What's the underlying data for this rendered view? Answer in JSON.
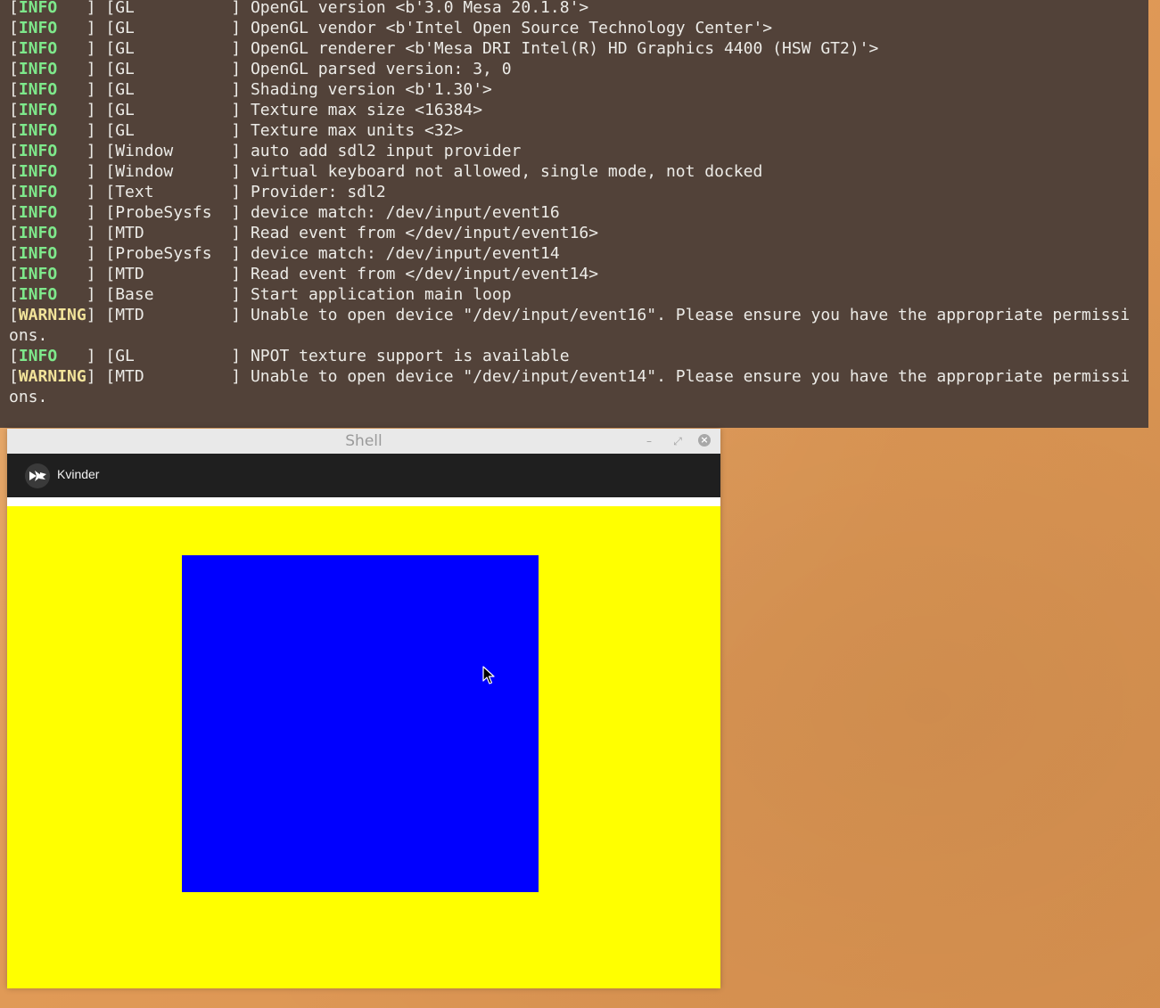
{
  "terminal": {
    "lines": [
      {
        "level": "INFO   ",
        "module": "GL          ",
        "message": "OpenGL version <b'3.0 Mesa 20.1.8'>"
      },
      {
        "level": "INFO   ",
        "module": "GL          ",
        "message": "OpenGL vendor <b'Intel Open Source Technology Center'>"
      },
      {
        "level": "INFO   ",
        "module": "GL          ",
        "message": "OpenGL renderer <b'Mesa DRI Intel(R) HD Graphics 4400 (HSW GT2)'>"
      },
      {
        "level": "INFO   ",
        "module": "GL          ",
        "message": "OpenGL parsed version: 3, 0"
      },
      {
        "level": "INFO   ",
        "module": "GL          ",
        "message": "Shading version <b'1.30'>"
      },
      {
        "level": "INFO   ",
        "module": "GL          ",
        "message": "Texture max size <16384>"
      },
      {
        "level": "INFO   ",
        "module": "GL          ",
        "message": "Texture max units <32>"
      },
      {
        "level": "INFO   ",
        "module": "Window      ",
        "message": "auto add sdl2 input provider"
      },
      {
        "level": "INFO   ",
        "module": "Window      ",
        "message": "virtual keyboard not allowed, single mode, not docked"
      },
      {
        "level": "INFO   ",
        "module": "Text        ",
        "message": "Provider: sdl2"
      },
      {
        "level": "INFO   ",
        "module": "ProbeSysfs  ",
        "message": "device match: /dev/input/event16"
      },
      {
        "level": "INFO   ",
        "module": "MTD         ",
        "message": "Read event from </dev/input/event16>"
      },
      {
        "level": "INFO   ",
        "module": "ProbeSysfs  ",
        "message": "device match: /dev/input/event14"
      },
      {
        "level": "INFO   ",
        "module": "MTD         ",
        "message": "Read event from </dev/input/event14>"
      },
      {
        "level": "INFO   ",
        "module": "Base        ",
        "message": "Start application main loop"
      },
      {
        "level": "WARNING",
        "module": "MTD         ",
        "message": "Unable to open device \"/dev/input/event16\". Please ensure you have the appropriate permissi"
      },
      {
        "level": "",
        "module": "",
        "message": "ons.",
        "continuation": true
      },
      {
        "level": "INFO   ",
        "module": "GL          ",
        "message": "NPOT texture support is available"
      },
      {
        "level": "WARNING",
        "module": "MTD         ",
        "message": "Unable to open device \"/dev/input/event14\". Please ensure you have the appropriate permissi"
      },
      {
        "level": "",
        "module": "",
        "message": "ons.",
        "continuation": true
      }
    ]
  },
  "window": {
    "title": "Shell",
    "minimize_glyph": "–",
    "maximize_glyph": "⤢",
    "close_glyph": "×",
    "app_name": "Kvinder",
    "logo_icon": "kivy-logo-icon"
  },
  "colors": {
    "terminal_bg": "#524239",
    "canvas_bg": "#ffff00",
    "square": "#0000ff",
    "info": "#7ee88b",
    "warning": "#f2e39a"
  }
}
